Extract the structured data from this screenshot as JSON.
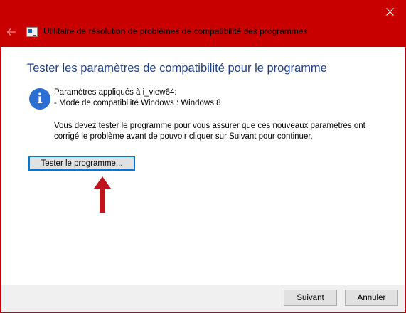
{
  "window": {
    "title": "Utilitaire de résolution de problèmes de compatibilité des programmes",
    "accent_color": "#c80000",
    "icons": {
      "close": "close-icon",
      "back": "back-arrow-icon",
      "app": "troubleshooter-icon"
    }
  },
  "main": {
    "heading": "Tester les paramètres de compatibilité pour le programme",
    "info": {
      "icon": "info-icon",
      "line1": "Paramètres appliqués à i_view64:",
      "line2": "- Mode de compatibilité Windows : Windows 8"
    },
    "message": "Vous devez tester le programme pour vous assurer que ces nouveaux paramètres ont corrigé le problème avant de pouvoir cliquer sur Suivant pour continuer.",
    "test_button_label": "Tester le programme...",
    "annotation_color": "#c0141c"
  },
  "footer": {
    "next_label": "Suivant",
    "cancel_label": "Annuler"
  }
}
